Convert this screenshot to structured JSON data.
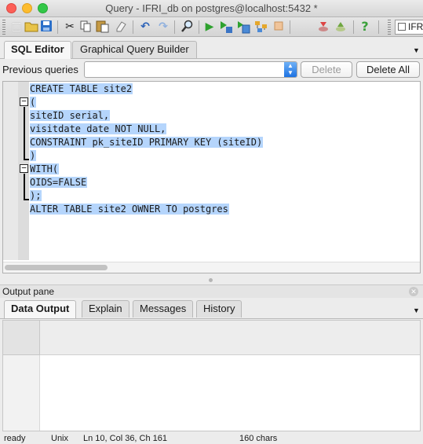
{
  "window": {
    "title": "Query - IFRI_db on postgres@localhost:5432 *"
  },
  "toolbar": {
    "icons": [
      "new-file-icon",
      "open-folder-icon",
      "save-icon",
      "cut-icon",
      "copy-icon",
      "paste-icon",
      "clear-icon",
      "undo-icon",
      "redo-icon",
      "find-icon",
      "execute-icon",
      "execute-pgscript-icon",
      "execute-to-file-icon",
      "explain-icon",
      "cancel-query-icon",
      "commit-icon",
      "rollback-icon",
      "help-icon"
    ],
    "combo_label": "IFR"
  },
  "editor_tabs": [
    {
      "label": "SQL Editor",
      "active": true
    },
    {
      "label": "Graphical Query Builder",
      "active": false
    }
  ],
  "previous_queries": {
    "label": "Previous queries",
    "value": "",
    "delete_label": "Delete",
    "delete_all_label": "Delete All"
  },
  "editor": {
    "lines": [
      "CREATE TABLE site2",
      "(",
      "siteID serial,",
      "visitdate date NOT NULL,",
      "CONSTRAINT pk_siteID PRIMARY KEY (siteID)",
      ")",
      "WITH(",
      "OIDS=FALSE",
      ");",
      "ALTER TABLE site2 OWNER TO postgres"
    ],
    "selection_color": "#b5d5fc"
  },
  "output": {
    "title": "Output pane",
    "tabs": [
      {
        "label": "Data Output",
        "active": true
      },
      {
        "label": "Explain",
        "active": false
      },
      {
        "label": "Messages",
        "active": false
      },
      {
        "label": "History",
        "active": false
      }
    ]
  },
  "status": {
    "state": "ready",
    "line_endings": "Unix",
    "position": "Ln 10, Col 36, Ch 161",
    "chars": "160 chars"
  }
}
